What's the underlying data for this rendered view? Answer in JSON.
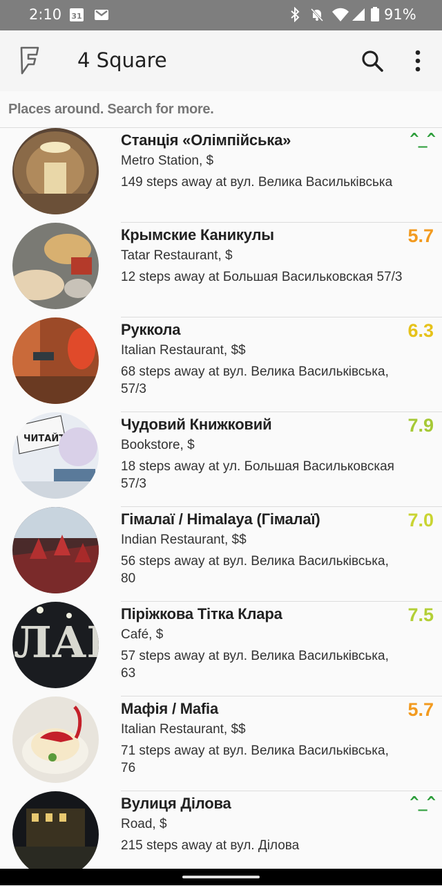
{
  "status_bar": {
    "time": "2:10",
    "battery": "91%",
    "calendar_day": "31"
  },
  "app_bar": {
    "title": "4 Square"
  },
  "hint": "Places around. Search for more.",
  "places": [
    {
      "name": "Станція «Олімпійська»",
      "category": "Metro Station, $",
      "address": "149 steps away at вул. Велика Васильківська",
      "score": "^_^",
      "score_color": "#2e9e3c",
      "is_face": true
    },
    {
      "name": "Крымские Каникулы",
      "category": "Tatar Restaurant, $",
      "address": "12 steps away at Большая Васильковская 57/3",
      "score": "5.7",
      "score_color": "#f29a1f",
      "is_face": false
    },
    {
      "name": "Руккола",
      "category": "Italian Restaurant, $$",
      "address": "68 steps away at вул. Велика Васильківська, 57/3",
      "score": "6.3",
      "score_color": "#e6c21a",
      "is_face": false
    },
    {
      "name": "Чудовий Книжковий",
      "category": "Bookstore, $",
      "address": "18 steps away at ул. Большая Васильковская 57/3",
      "score": "7.9",
      "score_color": "#a6c936",
      "is_face": false
    },
    {
      "name": "Гімалаї / Himalaya (Гімалаї)",
      "category": "Indian Restaurant, $$",
      "address": "56 steps away at вул. Велика Васильківська, 80",
      "score": "7.0",
      "score_color": "#c9d431",
      "is_face": false
    },
    {
      "name": "Піріжкова Тітка Клара",
      "category": "Café, $",
      "address": "57 steps away at вул. Велика Васильківська, 63",
      "score": "7.5",
      "score_color": "#b3cf36",
      "is_face": false
    },
    {
      "name": "Мафія / Mafia",
      "category": "Italian Restaurant, $$",
      "address": "71 steps away at вул. Велика Васильківська, 76",
      "score": "5.7",
      "score_color": "#f29a1f",
      "is_face": false
    },
    {
      "name": "Вулиця Ділова",
      "category": "Road, $",
      "address": "215 steps away at вул. Ділова",
      "score": "^_^",
      "score_color": "#2e9e3c",
      "is_face": true
    }
  ]
}
